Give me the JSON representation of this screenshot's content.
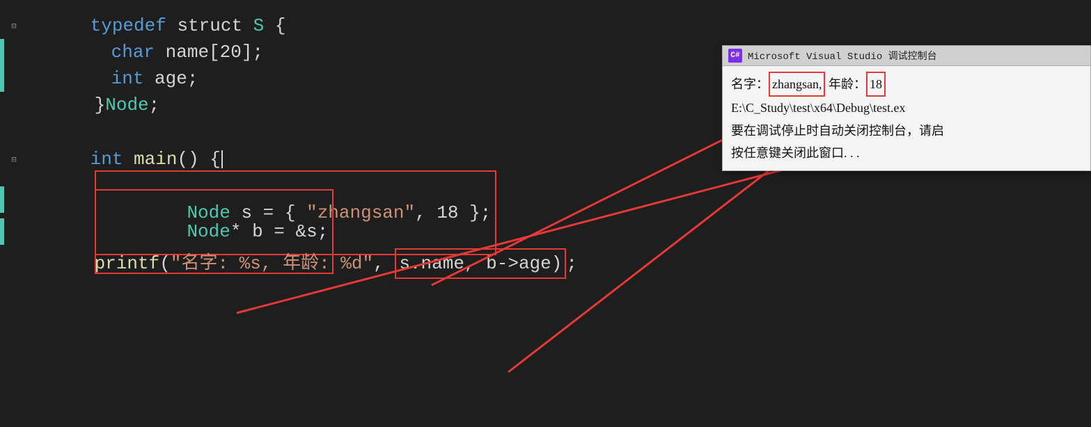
{
  "editor": {
    "lines": [
      {
        "id": "line-typedef",
        "indent": 0,
        "hasCollapse": true,
        "hasGreenBar": false,
        "hasLineIndicator": false,
        "content": [
          {
            "text": "typedef",
            "class": "kw-blue"
          },
          {
            "text": " struct ",
            "class": "kw-white"
          },
          {
            "text": "S",
            "class": "kw-green"
          },
          {
            "text": " {",
            "class": "kw-white"
          }
        ]
      },
      {
        "id": "line-char",
        "indent": 1,
        "hasCollapse": false,
        "content": [
          {
            "text": "    char ",
            "class": "kw-blue"
          },
          {
            "text": "name[20];",
            "class": "kw-white"
          }
        ]
      },
      {
        "id": "line-int-age",
        "indent": 1,
        "hasCollapse": false,
        "content": [
          {
            "text": "    int ",
            "class": "kw-blue"
          },
          {
            "text": "age;",
            "class": "kw-white"
          }
        ]
      },
      {
        "id": "line-closing-node",
        "indent": 0,
        "hasCollapse": false,
        "content": [
          {
            "text": "}",
            "class": "kw-white"
          },
          {
            "text": "Node",
            "class": "kw-green"
          },
          {
            "text": ";",
            "class": "kw-white"
          }
        ]
      },
      {
        "id": "line-int-main",
        "indent": 0,
        "hasCollapse": true,
        "hasGreenBar": true,
        "content": [
          {
            "text": "int ",
            "class": "kw-blue"
          },
          {
            "text": "main",
            "class": "kw-yellow"
          },
          {
            "text": "() {",
            "class": "kw-white"
          }
        ]
      },
      {
        "id": "line-node-s",
        "indent": 1,
        "hasCollapse": false,
        "annotationBox": true,
        "content": [
          {
            "text": "    Node ",
            "class": "kw-green"
          },
          {
            "text": "s = { ",
            "class": "kw-white"
          },
          {
            "text": "\"zhangsan\"",
            "class": "str-orange"
          },
          {
            "text": ", 18 };",
            "class": "kw-white"
          }
        ]
      },
      {
        "id": "line-node-b",
        "indent": 1,
        "hasCollapse": false,
        "annotationBox": true,
        "content": [
          {
            "text": "    Node",
            "class": "kw-green"
          },
          {
            "text": "* b = &s;",
            "class": "kw-white"
          }
        ]
      },
      {
        "id": "line-printf",
        "indent": 1,
        "hasCollapse": false,
        "content": [
          {
            "text": "    printf",
            "class": "kw-yellow"
          },
          {
            "text": "(",
            "class": "kw-white"
          },
          {
            "text": "\"名字: %s, 年龄: %d\"",
            "class": "str-orange"
          },
          {
            "text": ", ",
            "class": "kw-white"
          },
          {
            "text": "s.name, b->age",
            "class": "kw-white"
          },
          {
            "text": ");",
            "class": "kw-white"
          }
        ]
      }
    ]
  },
  "console": {
    "title": "Microsoft Visual Studio 调试控制台",
    "icon_text": "C#",
    "output_line1_prefix": "名字：",
    "output_line1_name": "zhangsan,",
    "output_line1_age_label": "年龄：",
    "output_line1_age": "18",
    "output_line2": "E:\\C_Study\\test\\x64\\Debug\\test.ex",
    "output_line3": "要在调试停止时自动关闭控制台，请启",
    "output_line4": "按任意键关闭此窗口. . ."
  },
  "annotations": {
    "box1_label": "Node s = { \"zhangsan\", 18 };",
    "box2_label": "Node* b = &s;",
    "box3_label": "zhangsan,",
    "box4_label": "18",
    "box5_label": "s.name, b->age)"
  }
}
